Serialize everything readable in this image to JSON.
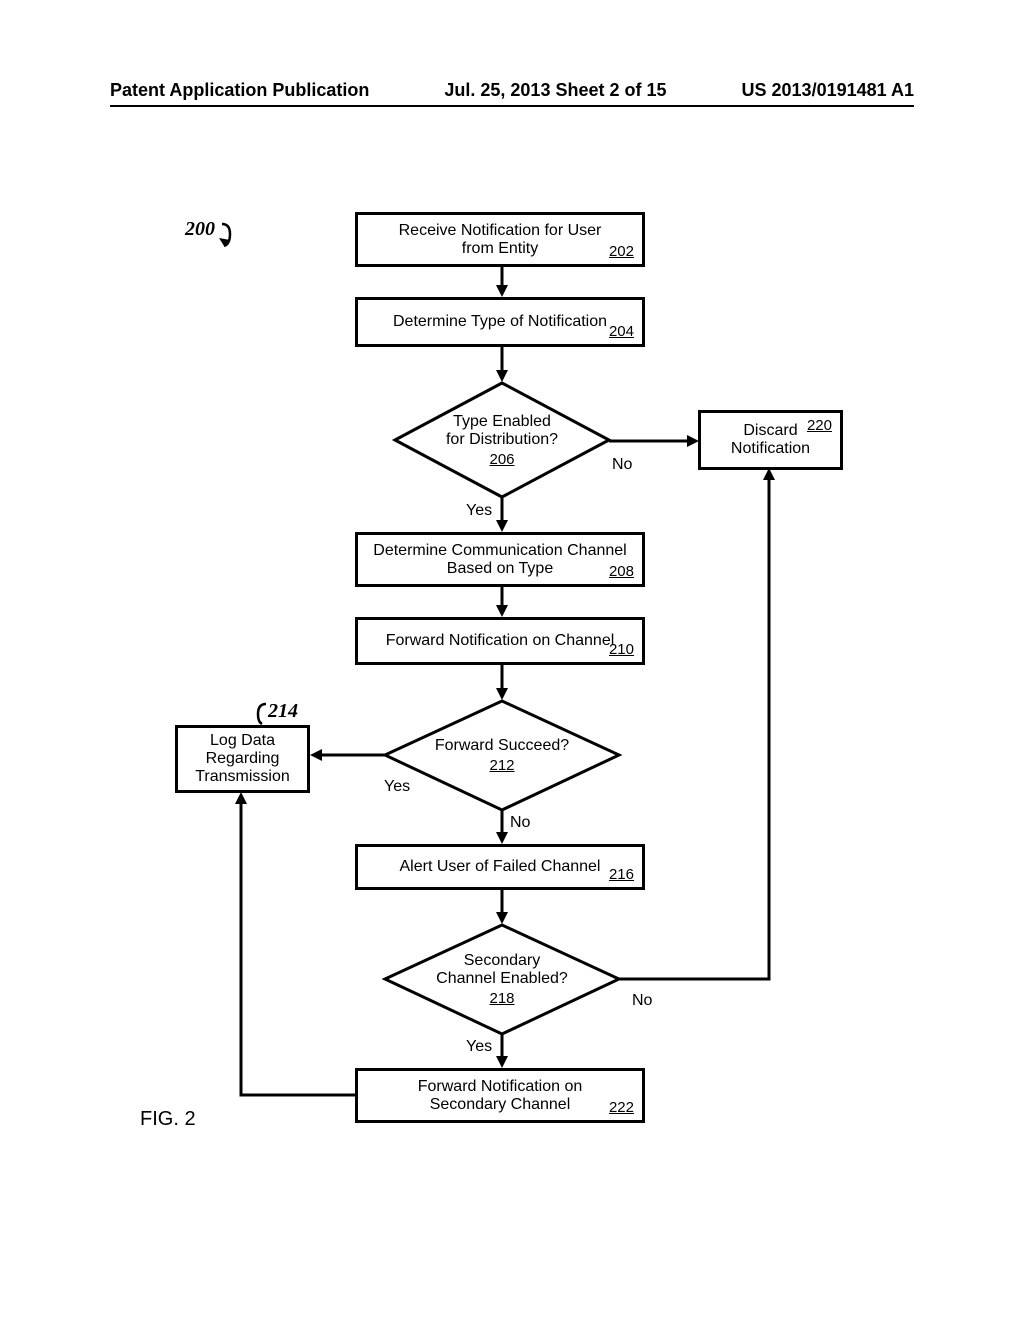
{
  "header": {
    "left": "Patent Application Publication",
    "center": "Jul. 25, 2013  Sheet 2 of 15",
    "right": "US 2013/0191481 A1"
  },
  "flow": {
    "ref200": "200",
    "fig_label": "FIG. 2",
    "box202": {
      "text": "Receive Notification for User\nfrom Entity",
      "ref": "202"
    },
    "box204": {
      "text": "Determine Type of Notification",
      "ref": "204"
    },
    "dec206": {
      "line1": "Type Enabled",
      "line2": "for Distribution?",
      "ref": "206",
      "yes": "Yes",
      "no": "No"
    },
    "box220": {
      "line1": "Discard",
      "line2": "Notification",
      "ref": "220"
    },
    "box208": {
      "text": "Determine Communication Channel\nBased on Type",
      "ref": "208"
    },
    "box210": {
      "text": "Forward Notification on Channel",
      "ref": "210"
    },
    "dec212": {
      "text": "Forward Succeed?",
      "ref": "212",
      "yes": "Yes",
      "no": "No"
    },
    "box214": {
      "ref": "214",
      "line1": "Log Data",
      "line2": "Regarding",
      "line3": "Transmission"
    },
    "box216": {
      "text": "Alert User of Failed Channel",
      "ref": "216"
    },
    "dec218": {
      "line1": "Secondary",
      "line2": "Channel Enabled?",
      "ref": "218",
      "yes": "Yes",
      "no": "No"
    },
    "box222": {
      "text": "Forward Notification on\nSecondary Channel",
      "ref": "222"
    }
  }
}
